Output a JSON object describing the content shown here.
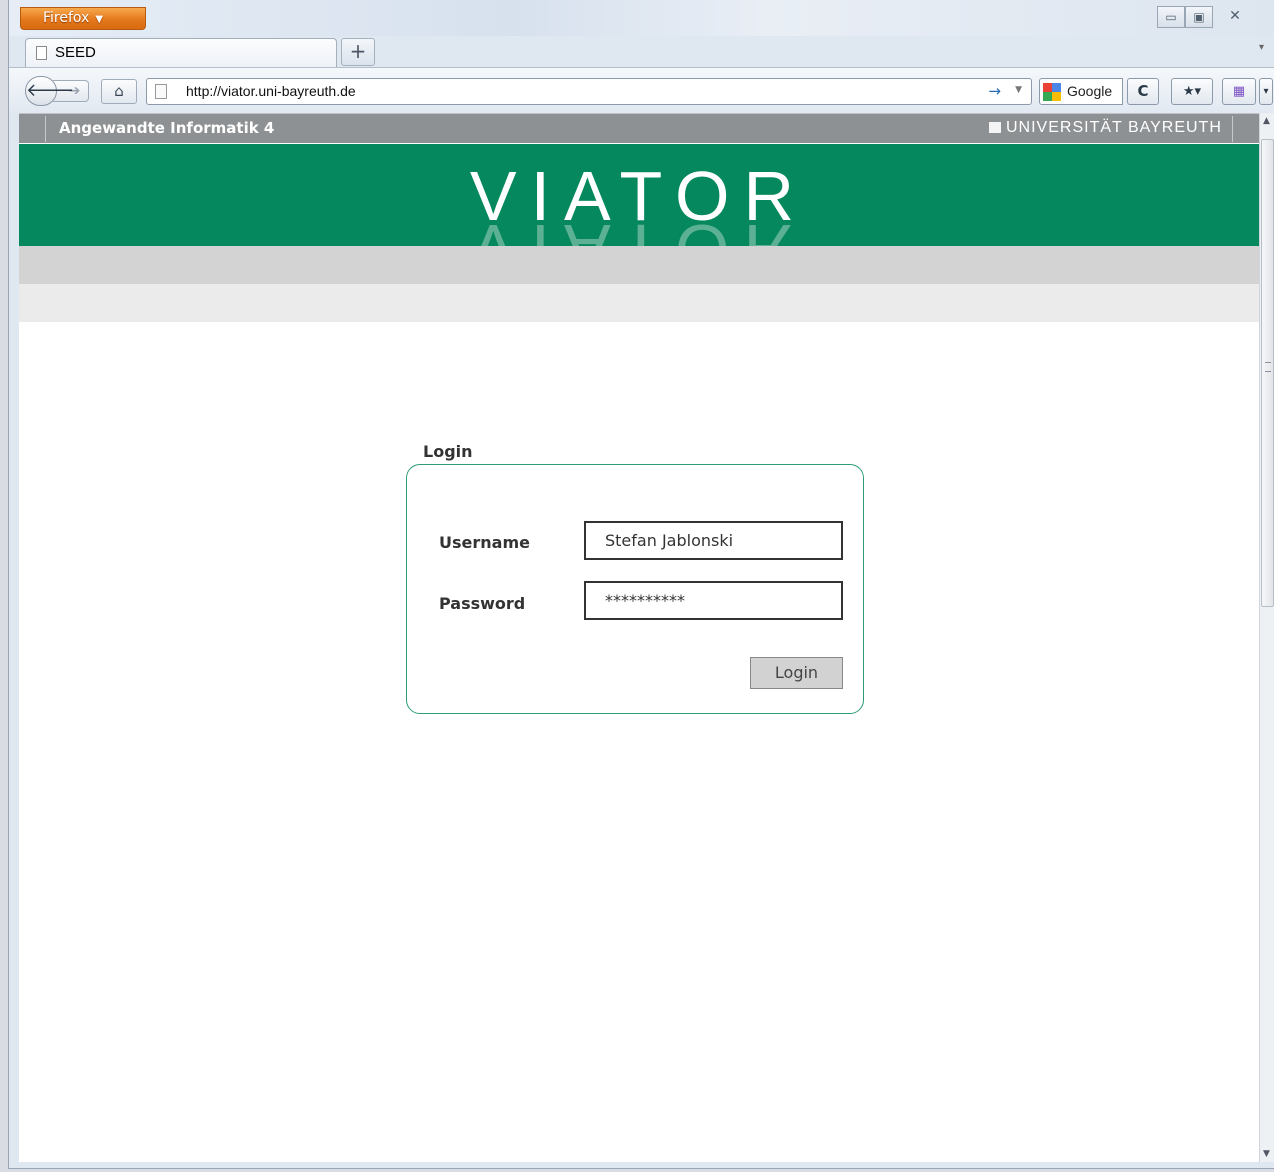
{
  "browser": {
    "menu_label": "Firefox",
    "tab_title": "SEED",
    "new_tab_symbol": "+",
    "url": "http://viator.uni-bayreuth.de",
    "search_engine": "Google",
    "window_controls": {
      "minimize": "▭",
      "maximize": "▣",
      "close": "✕"
    }
  },
  "header": {
    "department": "Angewandte Informatik 4",
    "university": "UNIVERSITÄT BAYREUTH",
    "logo_text": "VIATOR"
  },
  "login": {
    "legend": "Login",
    "username_label": "Username",
    "username_value": "Stefan Jablonski",
    "password_label": "Password",
    "password_value": "**********",
    "submit_label": "Login"
  },
  "colors": {
    "banner": "#05885d",
    "box_border": "#2e9b7b",
    "top_strip": "#8e9193"
  }
}
